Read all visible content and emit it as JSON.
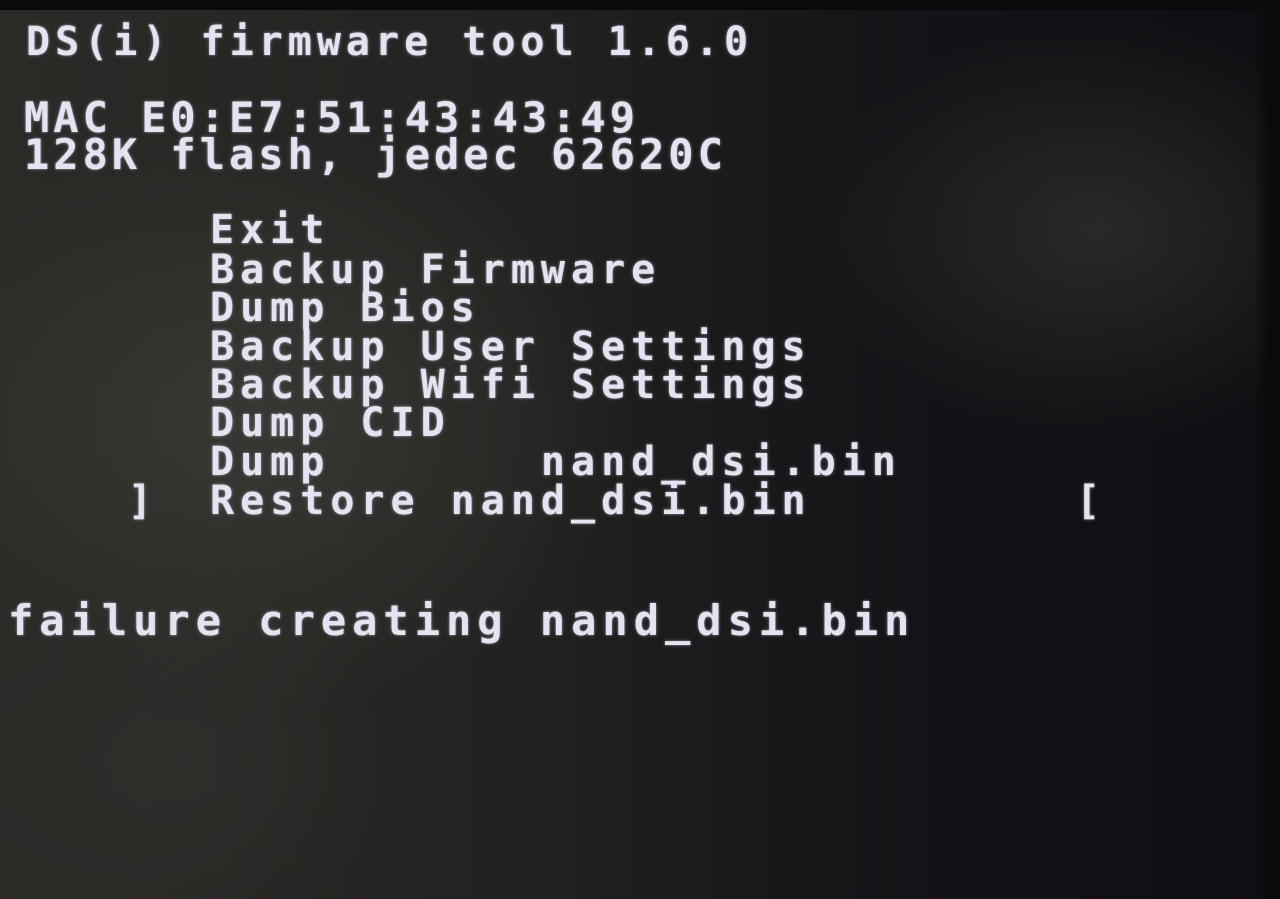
{
  "header": {
    "title": "DS(i) firmware tool 1.6.0",
    "mac_line": "MAC E0:E7:51:43:43:49",
    "flash_line": "128K flash, jedec 62620C"
  },
  "menu": {
    "items": [
      "Exit",
      "Backup Firmware",
      "Dump Bios",
      "Backup User Settings",
      "Backup Wifi Settings",
      "Dump CID",
      "Dump       nand_dsi.bin",
      "Restore nand_dsi.bin"
    ],
    "selected_index": 7,
    "cursor_left": "]",
    "cursor_right": "["
  },
  "status": {
    "message": "failure creating nand_dsi.bin"
  },
  "colors": {
    "text": "#e4e3f2",
    "background": "#151517"
  }
}
